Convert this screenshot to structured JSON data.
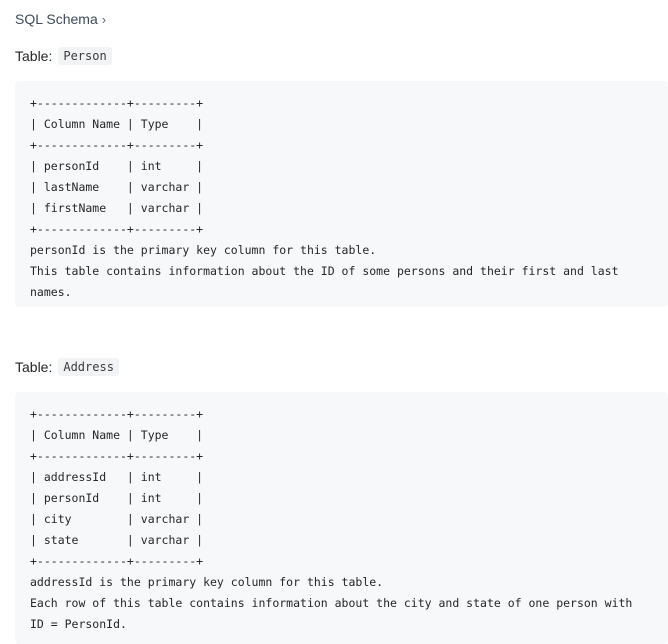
{
  "header": {
    "schema_link": "SQL Schema",
    "chevron": "›"
  },
  "tables": [
    {
      "label": "Table:",
      "name": "Person",
      "code": "+-------------+---------+\n| Column Name | Type    |\n+-------------+---------+\n| personId    | int     |\n| lastName    | varchar |\n| firstName   | varchar |\n+-------------+---------+\npersonId is the primary key column for this table.\nThis table contains information about the ID of some persons and their first and last\nnames."
    },
    {
      "label": "Table:",
      "name": "Address",
      "code": "+-------------+---------+\n| Column Name | Type    |\n+-------------+---------+\n| addressId   | int     |\n| personId    | int     |\n| city        | varchar |\n| state       | varchar |\n+-------------+---------+\naddressId is the primary key column for this table.\nEach row of this table contains information about the city and state of one person with\nID = PersonId."
    }
  ]
}
